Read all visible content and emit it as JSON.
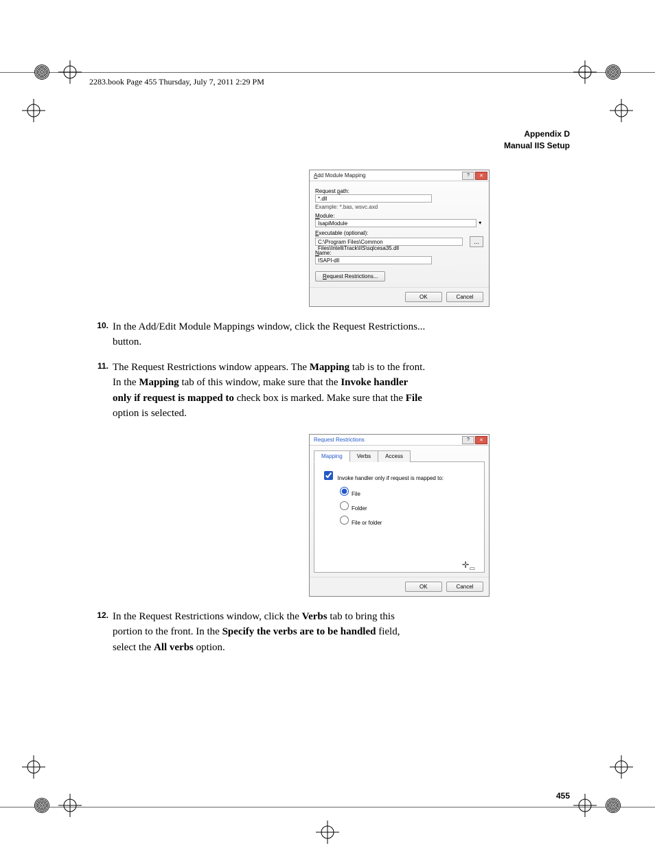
{
  "page_header": "2283.book  Page 455  Thursday, July 7, 2011  2:29 PM",
  "appendix": {
    "line1": "Appendix D",
    "line2": "Manual IIS Setup"
  },
  "dialog1": {
    "title": "Add Module Mapping",
    "request_path_label": "Request path:",
    "request_path_value": "*.dll",
    "example": "Example: *.bas, wsvc.axd",
    "module_label": "Module:",
    "module_value": "IsapiModule",
    "exe_label": "Executable (optional):",
    "exe_value": "C:\\Program Files\\Common Files\\IntelliTrack\\IIS\\sqlcesa35.dll",
    "name_label": "Name:",
    "name_value": "ISAPI-dll",
    "request_restrictions": "Request Restrictions...",
    "ok": "OK",
    "cancel": "Cancel",
    "browse": "..."
  },
  "dialog2": {
    "title": "Request Restrictions",
    "tabs": {
      "mapping": "Mapping",
      "verbs": "Verbs",
      "access": "Access"
    },
    "invoke_label": "Invoke handler only if request is mapped to:",
    "file": "File",
    "folder": "Folder",
    "file_or_folder": "File or folder",
    "ok": "OK",
    "cancel": "Cancel"
  },
  "steps": {
    "s10_num": "10.",
    "s10": "In the Add/Edit Module Mappings window, click the Request Restrictions... button.",
    "s11_num": "11.",
    "s11_a": "The Request Restrictions window appears. The ",
    "s11_b": "Mapping",
    "s11_c": " tab is to the front. In the ",
    "s11_d": "Mapping",
    "s11_e": " tab of this window, make sure that the ",
    "s11_f": "Invoke handler only if request is mapped to",
    "s11_g": " check box is marked. Make sure that the ",
    "s11_h": "File",
    "s11_i": " option is selected.",
    "s12_num": "12.",
    "s12_a": "In the Request Restrictions window, click the ",
    "s12_b": "Verbs",
    "s12_c": " tab to bring this portion to the front. In the ",
    "s12_d": "Specify the verbs are to be handled",
    "s12_e": " field, select the ",
    "s12_f": "All verbs",
    "s12_g": " option."
  },
  "page_number": "455"
}
